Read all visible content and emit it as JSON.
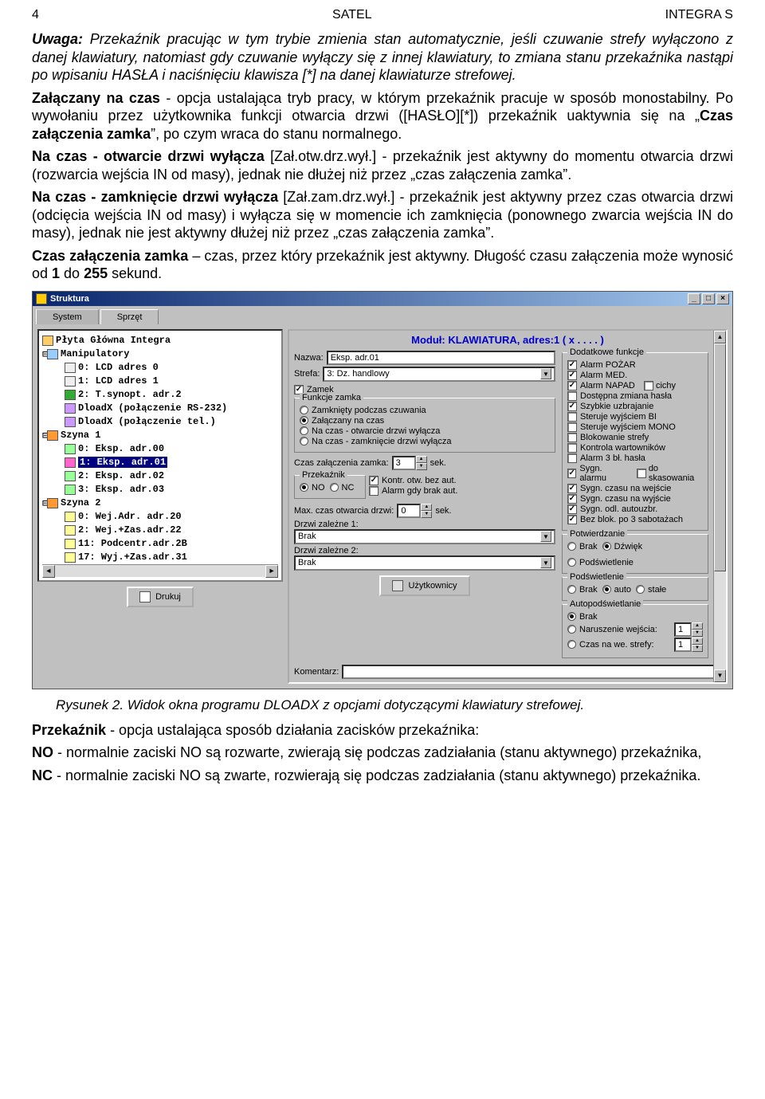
{
  "header": {
    "page": "4",
    "center": "SATEL",
    "right": "INTEGRA S"
  },
  "text": {
    "p1a": "Uwaga:",
    "p1b": " Przekaźnik pracując w tym trybie zmienia stan automatycznie, jeśli czuwanie strefy wyłączono z danej klawiatury, natomiast gdy czuwanie wyłączy się z innej klawiatury, to zmiana stanu przekaźnika nastąpi po wpisaniu HASŁA i naciśnięciu klawisza [*] na danej klawiaturze strefowej.",
    "p2a": "Załączany na czas",
    "p2b": " - opcja ustalająca tryb pracy, w którym przekaźnik pracuje w sposób monostabilny. Po wywołaniu przez użytkownika funkcji otwarcia drzwi ([HASŁO][*]) przekaźnik uaktywnia się na „",
    "p2c": "Czas załączenia zamka",
    "p2d": "”, po czym wraca do stanu normalnego.",
    "p3a": "Na czas - otwarcie drzwi wyłącza",
    "p3b": " [Zał.otw.drz.wył.] - przekaźnik jest aktywny do momentu otwarcia drzwi (rozwarcia wejścia IN od masy), jednak nie dłużej niż przez „czas załączenia zamka”.",
    "p4a": "Na czas - zamknięcie drzwi wyłącza",
    "p4b": " [Zał.zam.drz.wył.] - przekaźnik jest aktywny przez czas otwarcia drzwi (odcięcia wejścia IN od masy) i wyłącza się w momencie ich zamknięcia (ponownego zwarcia wejścia IN do masy), jednak nie jest aktywny dłużej niż przez „czas załączenia zamka”.",
    "p5a": "Czas załączenia zamka",
    "p5b": " – czas, przez który przekaźnik jest aktywny. Długość czasu załączenia może wynosić od ",
    "p5c": "1",
    "p5d": " do ",
    "p5e": "255",
    "p5f": " sekund."
  },
  "win": {
    "title": "Struktura",
    "tabs": {
      "system": "System",
      "sprzet": "Sprzęt"
    },
    "tree": {
      "root": "Płyta Główna Integra",
      "manip": "Manipulatory",
      "t0": "0: LCD adres 0",
      "t1": "1: LCD adres 1",
      "t2": "2: T.synopt. adr.2",
      "t3": "DloadX (połączenie RS-232)",
      "t4": "DloadX (połączenie tel.)",
      "sz1": "Szyna 1",
      "s10": "0: Eksp. adr.00",
      "s11": "1: Eksp. adr.01",
      "s12": "2: Eksp. adr.02",
      "s13": "3: Eksp. adr.03",
      "sz2": "Szyna 2",
      "s20": "0: Wej.Adr. adr.20",
      "s22": "2: Wej.+Zas.adr.22",
      "s2b": "11: Podcentr.adr.2B",
      "s31": "17: Wyj.+Zas.adr.31"
    },
    "printBtn": "Drukuj"
  },
  "mod": {
    "title": "Moduł: KLAWIATURA, adres:1 ( x . . . . )",
    "nazwaLbl": "Nazwa:",
    "nazwaVal": "Eksp. adr.01",
    "strefaLbl": "Strefa:",
    "strefaVal": "3: Dz. handlowy",
    "zamek": "Zamek",
    "funkcjeGroup": "Funkcje zamka",
    "f1": "Zamknięty podczas czuwania",
    "f2": "Załączany na czas",
    "f3": "Na czas - otwarcie drzwi wyłącza",
    "f4": "Na czas - zamknięcie drzwi wyłącza",
    "czasLbl": "Czas załączenia zamka:",
    "czasVal": "3",
    "sek": "sek.",
    "przekGroup": "Przekaźnik",
    "pno": "NO",
    "pnc": "NC",
    "kontr": "Kontr. otw. bez aut.",
    "alarmgdy": "Alarm gdy brak aut.",
    "maxLbl": "Max. czas otwarcia drzwi:",
    "maxVal": "0",
    "dz1Lbl": "Drzwi zależne 1:",
    "dz2Lbl": "Drzwi zależne 2:",
    "brak": "Brak",
    "uzytBtn": "Użytkownicy",
    "komentLbl": "Komentarz:"
  },
  "dk": {
    "group": "Dodatkowe funkcje",
    "a1": "Alarm POŻAR",
    "a2": "Alarm MED.",
    "a3": "Alarm NAPAD",
    "cichy": "cichy",
    "a4": "Dostępna zmiana hasła",
    "a5": "Szybkie uzbrajanie",
    "a6": "Steruje wyjściem BI",
    "a7": "Steruje wyjściem MONO",
    "a8": "Blokowanie strefy",
    "a9": "Kontrola wartowników",
    "a10": "Alarm 3 bł. hasła",
    "a11": "Sygn. alarmu",
    "a11b": "do skasowania",
    "a12": "Sygn. czasu na wejście",
    "a13": "Sygn. czasu na wyjście",
    "a14": "Sygn. odl. autouzbr.",
    "a15": "Bez blok. po 3 sabotażach",
    "potwGroup": "Potwierdzanie",
    "pBrak": "Brak",
    "pDzw": "Dźwięk",
    "pPod": "Podświetlenie",
    "podGroup": "Podświetlenie",
    "podBrak": "Brak",
    "podAuto": "auto",
    "podStale": "stałe",
    "autoGroup": "Autopodświetlanie",
    "auBrak": "Brak",
    "auNar": "Naruszenie wejścia:",
    "auCzas": "Czas na we. strefy:",
    "val1": "1"
  },
  "caption": "Rysunek 2. Widok okna programu DLOADX z opcjami dotyczącymi klawiatury strefowej.",
  "after": {
    "p1a": "Przekaźnik",
    "p1b": " - opcja ustalająca sposób działania zacisków przekaźnika:",
    "no_a": "NO",
    "no_b": " - normalnie zaciski NO są rozwarte, zwierają się podczas zadziałania (stanu aktywnego) przekaźnika,",
    "nc_a": "NC",
    "nc_b": " - normalnie zaciski NO są zwarte, rozwierają się podczas zadziałania (stanu aktywnego) przekaźnika."
  }
}
